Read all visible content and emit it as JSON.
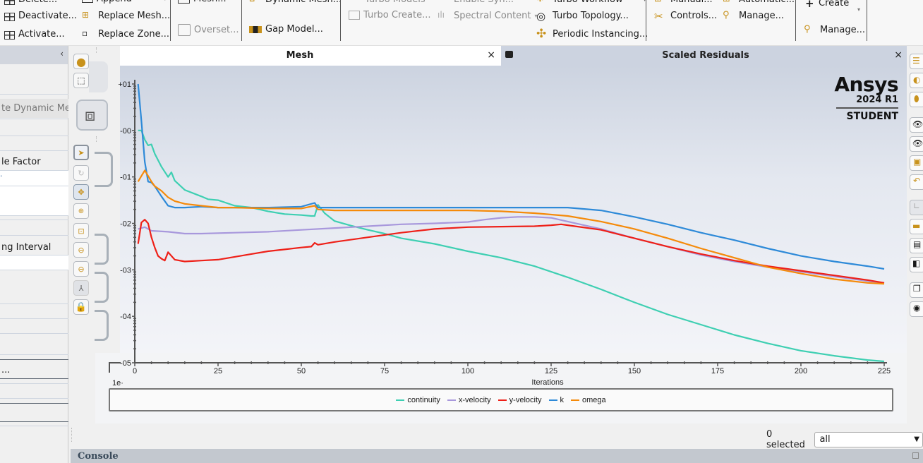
{
  "ribbon": {
    "groups": [
      {
        "items": [
          {
            "label": "Delete...",
            "icon": "delete-zone-icon"
          },
          {
            "label": "Deactivate...",
            "icon": "deactivate-icon"
          },
          {
            "label": "Activate...",
            "icon": "activate-icon"
          }
        ]
      },
      {
        "items": [
          {
            "label": "Append",
            "icon": "append-icon"
          },
          {
            "label": "Replace Mesh...",
            "icon": "replace-mesh-icon"
          },
          {
            "label": "Replace Zone...",
            "icon": "replace-zone-icon"
          }
        ]
      },
      {
        "items": [
          {
            "label": "Mesh...",
            "icon": "mesh-icon"
          },
          {
            "label": "Overset...",
            "icon": "overset-icon",
            "disabled": true
          }
        ]
      },
      {
        "items": [
          {
            "label": "Dynamic Mesh...",
            "icon": "dynamic-mesh-icon"
          },
          {
            "label": "Gap Model...",
            "icon": "gap-model-icon"
          }
        ]
      },
      {
        "items": [
          {
            "label": "Turbo Models",
            "icon": "turbo-models-icon",
            "disabled": true
          },
          {
            "label": "Turbo Create...",
            "icon": "turbo-create-icon",
            "disabled": true
          },
          {
            "label": "Enable Syn...",
            "icon": "enable-syn-icon",
            "disabled": true
          },
          {
            "label": "Spectral Content",
            "icon": "spectral-content-icon",
            "disabled": true
          }
        ]
      },
      {
        "items": [
          {
            "label": "Turbo Workflow",
            "icon": "turbo-workflow-icon"
          },
          {
            "label": "Turbo Topology...",
            "icon": "turbo-topology-icon"
          },
          {
            "label": "Periodic Instancing...",
            "icon": "periodic-instancing-icon"
          }
        ]
      },
      {
        "items": [
          {
            "label": "Manual...",
            "icon": "manual-icon"
          },
          {
            "label": "Automatic...",
            "icon": "automatic-icon"
          },
          {
            "label": "Controls...",
            "icon": "controls-icon"
          },
          {
            "label": "Manage...",
            "icon": "manage-icon"
          }
        ]
      },
      {
        "items": [
          {
            "label": "Create",
            "icon": "plus-icon"
          },
          {
            "label": "Manage...",
            "icon": "manage-icon"
          }
        ]
      }
    ]
  },
  "left_panel": {
    "rows": [
      "te Dynamic Mesh",
      "le Factor",
      "",
      "ng Interval",
      "..."
    ]
  },
  "tabs": {
    "mesh": {
      "title": "Mesh",
      "close": "×"
    },
    "residuals": {
      "title": "Scaled Residuals",
      "close": "×"
    }
  },
  "logo": {
    "brand": "Ansys",
    "version": "2024 R1",
    "edition": "STUDENT"
  },
  "selection": {
    "count_label": "0 selected",
    "filter_value": "all"
  },
  "console": {
    "label": "Console"
  },
  "chart_data": {
    "type": "line",
    "title": "Scaled Residuals",
    "xlabel": "Iterations",
    "ylabel": "",
    "yscale": "log",
    "xlim": [
      0,
      225
    ],
    "ylim": [
      1e-05,
      10
    ],
    "x_ticks": [
      0,
      25,
      50,
      75,
      100,
      125,
      150,
      175,
      200,
      225
    ],
    "y_tick_labels": [
      "+01",
      "-00",
      "-01",
      "-02",
      "-03",
      "-04",
      "-05"
    ],
    "y_tick_exponents": [
      1,
      0,
      -1,
      -2,
      -3,
      -4,
      -5
    ],
    "y_prefix": "1e",
    "legend_position": "bottom",
    "series": [
      {
        "name": "continuity",
        "color": "#3ecfb2",
        "x": [
          1,
          2,
          3,
          4,
          5,
          6,
          8,
          10,
          11,
          12,
          15,
          20,
          22,
          25,
          30,
          35,
          40,
          45,
          50,
          53,
          54,
          55,
          57,
          60,
          65,
          70,
          75,
          80,
          90,
          100,
          110,
          120,
          130,
          140,
          150,
          160,
          170,
          180,
          190,
          200,
          210,
          220,
          225
        ],
        "log10": [
          0.0,
          0.0,
          -0.2,
          -0.32,
          -0.3,
          -0.5,
          -0.78,
          -1.0,
          -0.9,
          -1.08,
          -1.28,
          -1.42,
          -1.48,
          -1.5,
          -1.62,
          -1.66,
          -1.74,
          -1.8,
          -1.82,
          -1.84,
          -1.84,
          -1.6,
          -1.78,
          -1.95,
          -2.05,
          -2.14,
          -2.22,
          -2.32,
          -2.44,
          -2.6,
          -2.74,
          -2.92,
          -3.16,
          -3.42,
          -3.7,
          -3.96,
          -4.18,
          -4.4,
          -4.58,
          -4.74,
          -4.85,
          -4.94,
          -4.97
        ]
      },
      {
        "name": "x-velocity",
        "color": "#a898dc",
        "x": [
          1,
          3,
          5,
          10,
          15,
          20,
          30,
          40,
          50,
          60,
          70,
          80,
          90,
          100,
          105,
          110,
          115,
          120,
          125,
          130,
          140,
          150,
          160,
          170,
          180,
          190,
          200,
          210,
          220,
          225
        ],
        "log10": [
          -2.12,
          -2.08,
          -2.16,
          -2.18,
          -2.22,
          -2.22,
          -2.2,
          -2.18,
          -2.14,
          -2.1,
          -2.06,
          -2.02,
          -2.0,
          -1.97,
          -1.92,
          -1.88,
          -1.86,
          -1.86,
          -1.88,
          -1.96,
          -2.12,
          -2.32,
          -2.5,
          -2.68,
          -2.82,
          -2.94,
          -3.04,
          -3.14,
          -3.24,
          -3.28
        ]
      },
      {
        "name": "y-velocity",
        "color": "#ee2018",
        "x": [
          1,
          2,
          3,
          4,
          5,
          6,
          7,
          8,
          9,
          10,
          12,
          15,
          20,
          25,
          30,
          35,
          40,
          45,
          50,
          53,
          54,
          55,
          60,
          70,
          80,
          90,
          100,
          110,
          120,
          125,
          128,
          130,
          140,
          150,
          160,
          170,
          180,
          190,
          200,
          210,
          220,
          225
        ],
        "log10": [
          -2.44,
          -1.98,
          -1.92,
          -2.0,
          -2.3,
          -2.52,
          -2.7,
          -2.76,
          -2.8,
          -2.62,
          -2.78,
          -2.82,
          -2.8,
          -2.78,
          -2.72,
          -2.66,
          -2.6,
          -2.56,
          -2.52,
          -2.5,
          -2.42,
          -2.46,
          -2.4,
          -2.3,
          -2.2,
          -2.12,
          -2.08,
          -2.07,
          -2.06,
          -2.04,
          -2.02,
          -2.04,
          -2.14,
          -2.32,
          -2.5,
          -2.66,
          -2.8,
          -2.92,
          -3.02,
          -3.12,
          -3.22,
          -3.28
        ]
      },
      {
        "name": "k",
        "color": "#2e8ad8",
        "x": [
          1,
          2,
          3,
          4,
          5,
          6,
          8,
          10,
          12,
          15,
          20,
          25,
          30,
          40,
          50,
          54,
          55,
          60,
          70,
          80,
          100,
          120,
          130,
          140,
          150,
          160,
          170,
          180,
          190,
          200,
          210,
          220,
          225
        ],
        "log10": [
          1.0,
          0.2,
          -0.68,
          -1.1,
          -1.12,
          -1.2,
          -1.42,
          -1.62,
          -1.66,
          -1.66,
          -1.64,
          -1.66,
          -1.66,
          -1.66,
          -1.64,
          -1.56,
          -1.66,
          -1.66,
          -1.66,
          -1.66,
          -1.66,
          -1.66,
          -1.66,
          -1.72,
          -1.86,
          -2.02,
          -2.2,
          -2.36,
          -2.54,
          -2.7,
          -2.82,
          -2.92,
          -2.98
        ]
      },
      {
        "name": "omega",
        "color": "#f58a0a",
        "x": [
          1,
          2,
          3,
          4,
          5,
          6,
          8,
          10,
          12,
          15,
          20,
          25,
          30,
          40,
          50,
          54,
          55,
          60,
          80,
          100,
          110,
          120,
          130,
          140,
          150,
          160,
          170,
          180,
          190,
          200,
          210,
          220,
          225
        ],
        "log10": [
          -1.1,
          -0.98,
          -0.86,
          -0.98,
          -1.1,
          -1.2,
          -1.3,
          -1.44,
          -1.52,
          -1.58,
          -1.62,
          -1.66,
          -1.66,
          -1.68,
          -1.68,
          -1.62,
          -1.7,
          -1.72,
          -1.72,
          -1.72,
          -1.74,
          -1.78,
          -1.84,
          -1.96,
          -2.12,
          -2.32,
          -2.54,
          -2.74,
          -2.94,
          -3.08,
          -3.2,
          -3.28,
          -3.3
        ]
      }
    ]
  }
}
